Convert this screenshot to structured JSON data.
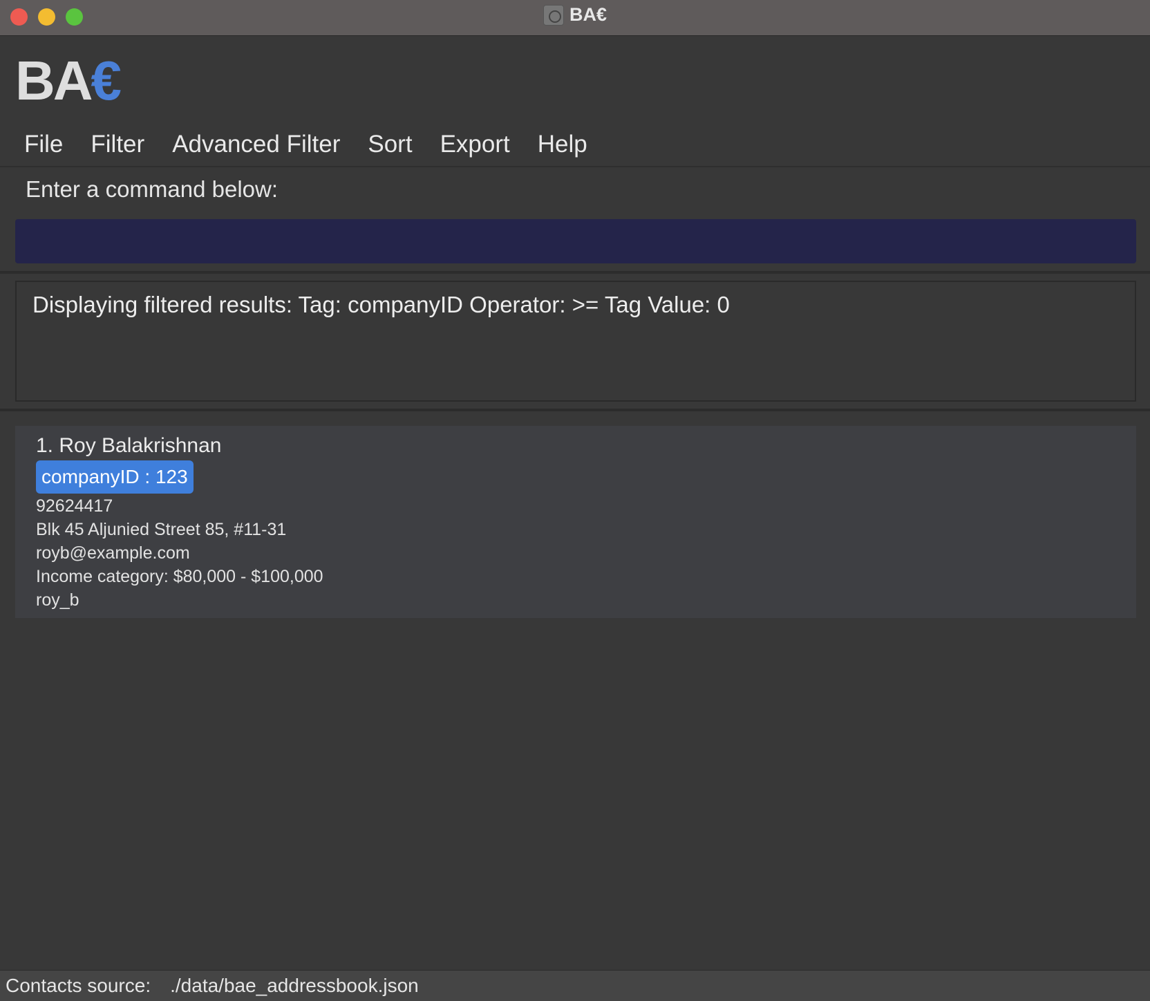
{
  "window": {
    "title": "BA€"
  },
  "logo": {
    "main": "BA",
    "accent": "€"
  },
  "menu": {
    "items": [
      "File",
      "Filter",
      "Advanced Filter",
      "Sort",
      "Export",
      "Help"
    ]
  },
  "command": {
    "label": "Enter a command below:",
    "value": "",
    "placeholder": ""
  },
  "result": {
    "text": "Displaying filtered results: Tag: companyID Operator: >= Tag Value: 0"
  },
  "contacts": [
    {
      "name": "1. Roy Balakrishnan",
      "tag": "companyID : 123",
      "phone": "92624417",
      "address": "Blk 45 Aljunied Street 85, #11-31",
      "email": "royb@example.com",
      "income": "Income category: $80,000 - $100,000",
      "handle": "roy_b"
    }
  ],
  "status": {
    "label": "Contacts source:",
    "path": "./data/bae_addressbook.json"
  },
  "colors": {
    "accent": "#4a80d8",
    "tag_bg": "#3f7fdc",
    "command_bg": "#24244a",
    "window_bg": "#383838",
    "titlebar_bg": "#5f5b5b"
  }
}
